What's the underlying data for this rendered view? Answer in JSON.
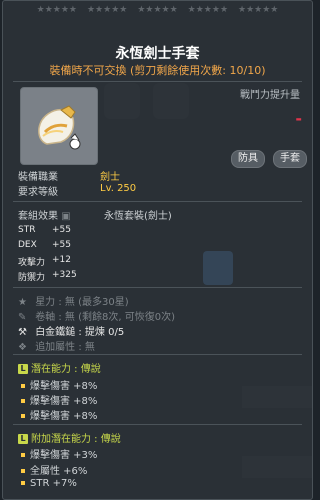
{
  "stars": {
    "g1": "★★★★★",
    "g2": "★★★★★",
    "g3": "★★★★★",
    "g4": "★★★★★",
    "g5": "★★★★★"
  },
  "item": {
    "name": "永恆劍士手套",
    "trade_warning": "裝備時不可交換 (剪刀剩餘使用次數: 10/10)"
  },
  "power": {
    "label": "戰鬥力提升量",
    "value": "-"
  },
  "tags": {
    "armor": "防具",
    "gloves": "手套"
  },
  "req": {
    "job_label": "裝備職業",
    "job_value": "劍士",
    "level_label": "要求等級",
    "level_value": "Lv. 250"
  },
  "set": {
    "label": "套組效果",
    "name": "永恆套裝(劍士)"
  },
  "stats": [
    {
      "k": "STR",
      "v": "+55"
    },
    {
      "k": "DEX",
      "v": "+55"
    },
    {
      "k": "攻擊力",
      "v": "+12"
    },
    {
      "k": "防禦力",
      "v": "+325"
    }
  ],
  "info": {
    "starforce": "星力 : 無 (最多30星)",
    "scroll": "卷軸 : 無 (剩餘8次, 可恢復0次)",
    "hammer": "白金鐵鎚 : 提煉 0/5",
    "flame": "追加屬性 : 無"
  },
  "potential": {
    "title": "潛在能力 : 傳說",
    "lines": [
      "爆擊傷害 +8%",
      "爆擊傷害 +8%",
      "爆擊傷害 +8%"
    ]
  },
  "additional": {
    "title": "附加潛在能力 : 傳說",
    "lines": [
      "爆擊傷害 +3%",
      "全屬性 +6%",
      "STR +7%"
    ]
  }
}
